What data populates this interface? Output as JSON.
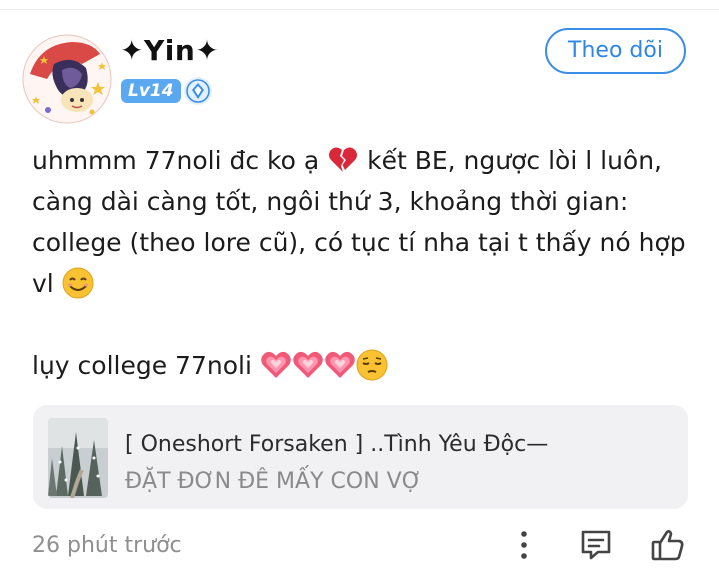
{
  "header": {
    "username": "✦Yin✦",
    "level": "Lv14",
    "follow_label": "Theo dõi"
  },
  "post": {
    "line1_a": "uhmmm 77noli đc ko ạ ",
    "line1_b": " kết BE, ngược lòi l luôn,",
    "line2": "càng dài càng tốt, ngôi thứ 3, khoảng thời gian:",
    "line3": "college (theo lore cũ), có tục tí nha tại t thấy nó hợp",
    "line4": "vl ",
    "line5": "lụy college 77noli "
  },
  "linked_post": {
    "title": "[ Oneshort Forsaken ] ..Tình Yêu Độc—",
    "subtitle": "ĐẶT ĐƠN ĐÊ MẤY CON VỢ"
  },
  "footer": {
    "timestamp": "26 phút trước"
  },
  "icons": {
    "broken_heart": "broken-heart-emoji",
    "smile": "smiling-face-emoji",
    "hearts": "sparkling-heart-emoji",
    "pensive": "pensive-face-emoji",
    "more": "more-vertical-icon",
    "comment": "comment-icon",
    "like": "thumbs-up-icon",
    "verify": "verified-badge-icon"
  },
  "colors": {
    "accent": "#2f86e6",
    "level_badge": "#5aa9f0",
    "card_bg": "#f1f1f3",
    "muted_text": "#8f8f8f"
  }
}
